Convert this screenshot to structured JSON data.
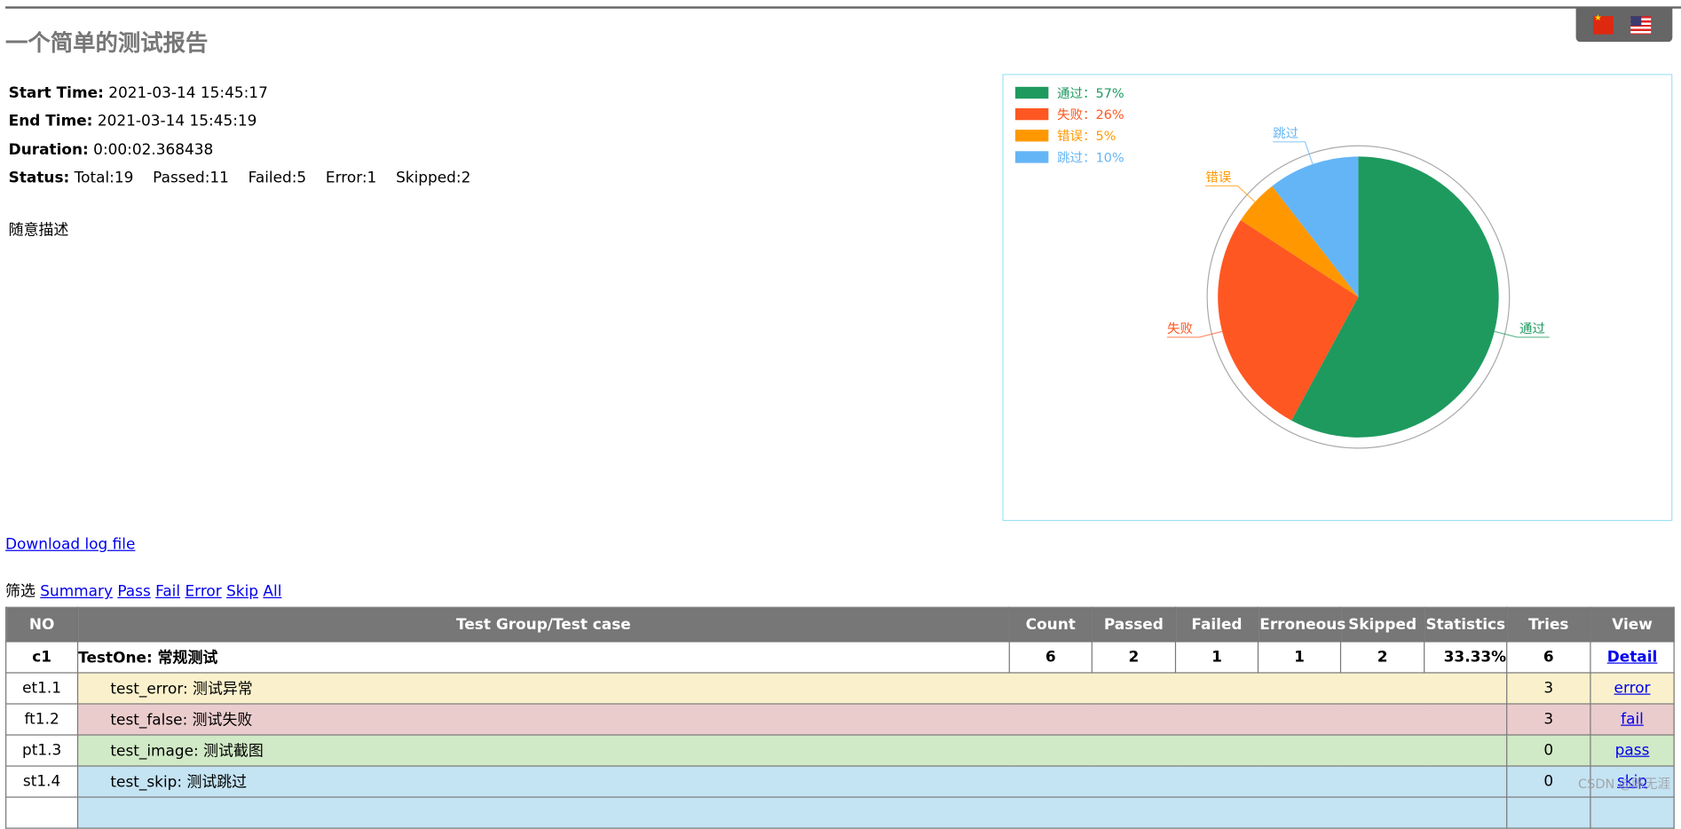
{
  "title": "一个简单的测试报告",
  "info": {
    "start_label": "Start Time:",
    "start": "2021-03-14 15:45:17",
    "end_label": "End Time:",
    "end": "2021-03-14 15:45:19",
    "duration_label": "Duration:",
    "duration": "0:00:02.368438",
    "status_label": "Status:",
    "total": "Total:19",
    "passed": "Passed:11",
    "failed": "Failed:5",
    "error": "Error:1",
    "skipped": "Skipped:2"
  },
  "description": "随意描述",
  "flags": [
    "china-flag-icon",
    "usa-flag-icon"
  ],
  "chart_data": {
    "type": "pie",
    "categories": [
      "通过",
      "失败",
      "错误",
      "跳过"
    ],
    "values": [
      11,
      5,
      1,
      2
    ],
    "legend": [
      "通过：57%",
      "失败：26%",
      "错误：5%",
      "跳过：10%"
    ],
    "colors": [
      "#1e9a5f",
      "#ff5722",
      "#ff9800",
      "#64b5f6"
    ],
    "legend_position": "top-left"
  },
  "download_label": "Download log file",
  "filter": {
    "label": "筛选",
    "links": [
      "Summary",
      "Pass",
      "Fail",
      "Error",
      "Skip",
      "All"
    ]
  },
  "table": {
    "headers": [
      "NO",
      "Test Group/Test case",
      "Count",
      "Passed",
      "Failed",
      "Erroneous",
      "Skipped",
      "Statistics",
      "Tries",
      "View"
    ],
    "group": {
      "no": "c1",
      "name": "TestOne: 常规测试",
      "count": "6",
      "passed": "2",
      "failed": "1",
      "erroneous": "1",
      "skipped": "2",
      "statistics": "33.33%",
      "tries": "6",
      "view": "Detail"
    },
    "cases": [
      {
        "no": "et1.1",
        "name": "test_error: 测试异常",
        "tries": "3",
        "view": "error",
        "status": "err"
      },
      {
        "no": "ft1.2",
        "name": "test_false: 测试失败",
        "tries": "3",
        "view": "fail",
        "status": "fail"
      },
      {
        "no": "pt1.3",
        "name": "test_image: 测试截图",
        "tries": "0",
        "view": "pass",
        "status": "pass"
      },
      {
        "no": "st1.4",
        "name": "test_skip: 测试跳过",
        "tries": "0",
        "view": "skip",
        "status": "skip"
      }
    ]
  },
  "watermark": "CSDN @陈无涯"
}
